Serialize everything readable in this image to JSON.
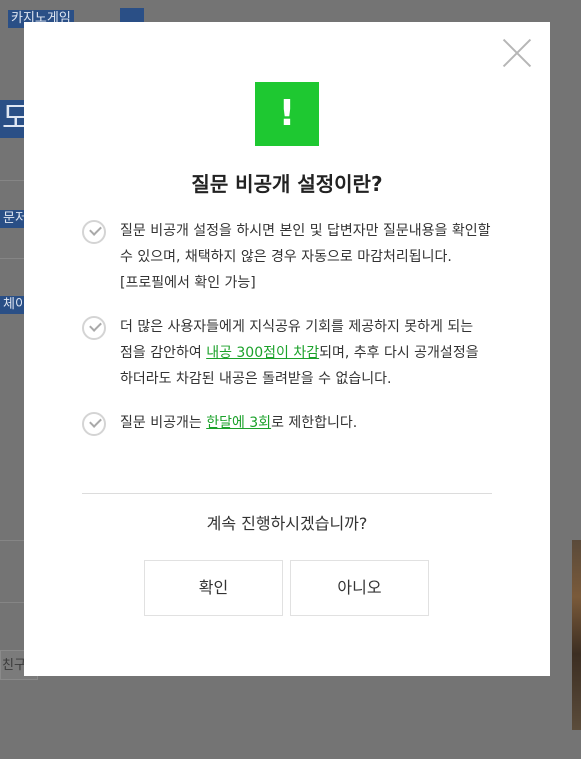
{
  "background": {
    "chip_top": "카지노게임",
    "chip_big": "도",
    "chip_mid": "문저",
    "chip_low": "체이",
    "friend_button": "친구"
  },
  "modal": {
    "alert_symbol": "!",
    "title": "질문 비공개 설정이란?",
    "items": [
      {
        "text": "질문 비공개 설정을 하시면 본인 및 답변자만 질문내용을 확인할 수 있으며, 채택하지 않은 경우 자동으로 마감처리됩니다. [프로필에서 확인 가능]"
      },
      {
        "text_before": "더 많은 사용자들에게 지식공유 기회를 제공하지 못하게 되는 점을 감안하여 ",
        "link": "내공 300점이 차감",
        "text_after": "되며, 추후 다시 공개설정을 하더라도 차감된 내공은 돌려받을 수 없습니다."
      },
      {
        "text_before": "질문 비공개는 ",
        "link": "한달에 3회",
        "text_after": "로 제한합니다."
      }
    ],
    "question": "계속 진행하시겠습니까?",
    "confirm_label": "확인",
    "cancel_label": "아니오"
  },
  "colors": {
    "accent_green": "#1ec831",
    "link_green": "#1ba12a",
    "overlay": "#6f6f6f"
  },
  "icons": [
    "close-icon",
    "alert-icon",
    "check-circle-icon"
  ]
}
